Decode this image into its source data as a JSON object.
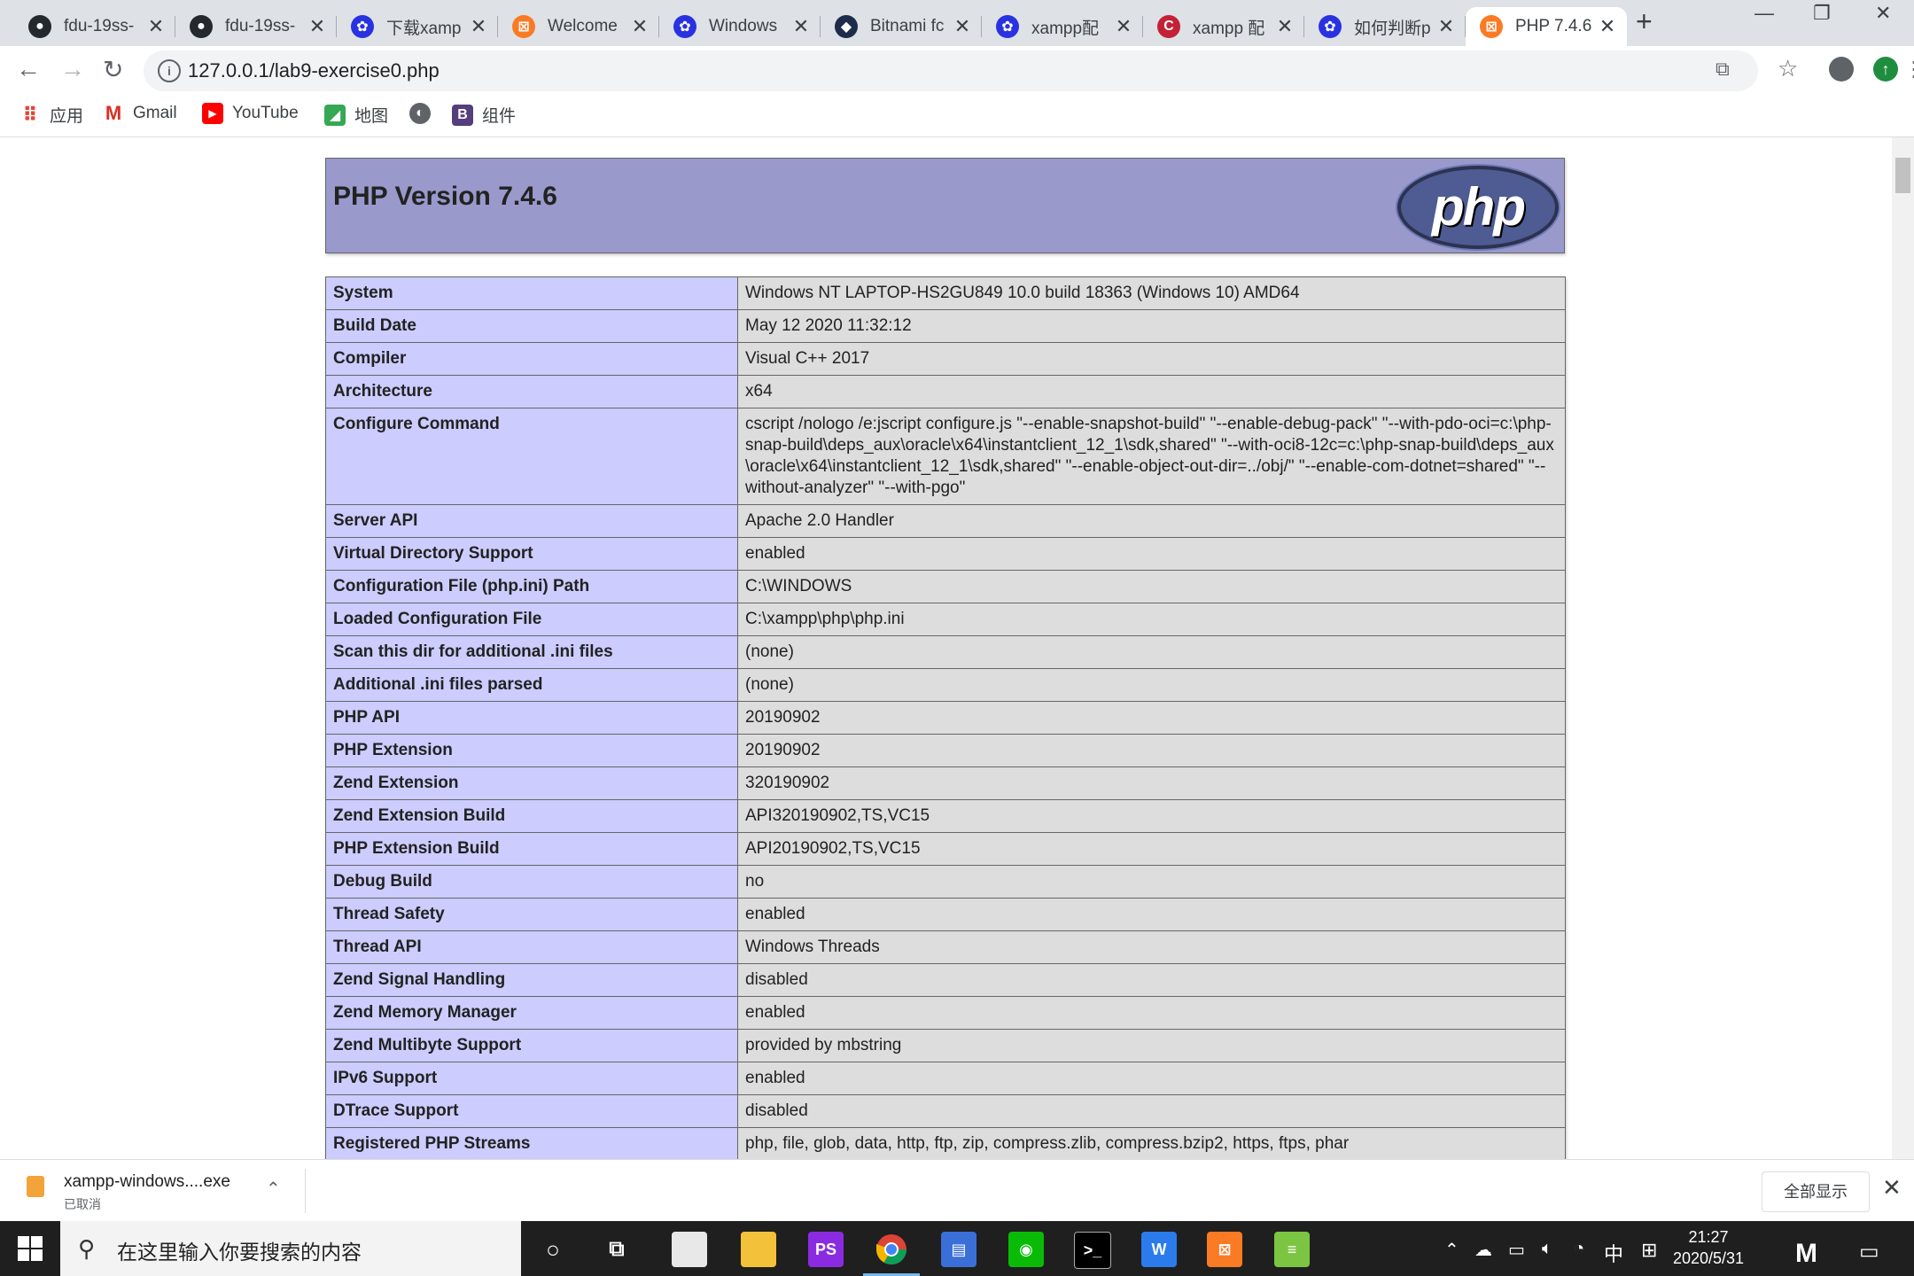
{
  "browser": {
    "tabs": [
      {
        "title": "fdu-19ss-",
        "icon": "github-icon"
      },
      {
        "title": "fdu-19ss-",
        "icon": "github-icon"
      },
      {
        "title": "下载xamp",
        "icon": "baidu-paw-icon"
      },
      {
        "title": "Welcome",
        "icon": "xampp-icon"
      },
      {
        "title": "Windows",
        "icon": "baidu-paw-icon"
      },
      {
        "title": "Bitnami fc",
        "icon": "bitnami-icon"
      },
      {
        "title": "xampp配",
        "icon": "baidu-paw-icon"
      },
      {
        "title": "xampp 配",
        "icon": "csdn-icon"
      },
      {
        "title": "如何判断p",
        "icon": "baidu-paw-icon"
      },
      {
        "title": "PHP 7.4.6",
        "icon": "xampp-icon",
        "active": true
      }
    ],
    "new_tab": "+",
    "url": "127.0.0.1/lab9-exercise0.php",
    "bookmarks": [
      {
        "label": "应用",
        "icon": "apps-grid-icon"
      },
      {
        "label": "Gmail",
        "icon": "gmail-icon"
      },
      {
        "label": "YouTube",
        "icon": "youtube-icon"
      },
      {
        "label": "地图",
        "icon": "maps-icon"
      },
      {
        "label": "",
        "icon": "globe-icon"
      },
      {
        "label": "组件",
        "icon": "bootstrap-icon"
      }
    ]
  },
  "page": {
    "title": "PHP Version 7.4.6",
    "logo_text": "php",
    "rows": [
      {
        "key": "System",
        "value": "Windows NT LAPTOP-HS2GU849 10.0 build 18363 (Windows 10) AMD64"
      },
      {
        "key": "Build Date",
        "value": "May 12 2020 11:32:12"
      },
      {
        "key": "Compiler",
        "value": "Visual C++ 2017"
      },
      {
        "key": "Architecture",
        "value": "x64"
      },
      {
        "key": "Configure Command",
        "value": "cscript /nologo /e:jscript configure.js \"--enable-snapshot-build\" \"--enable-debug-pack\" \"--with-pdo-oci=c:\\php-snap-build\\deps_aux\\oracle\\x64\\instantclient_12_1\\sdk,shared\" \"--with-oci8-12c=c:\\php-snap-build\\deps_aux\\oracle\\x64\\instantclient_12_1\\sdk,shared\" \"--enable-object-out-dir=../obj/\" \"--enable-com-dotnet=shared\" \"--without-analyzer\" \"--with-pgo\""
      },
      {
        "key": "Server API",
        "value": "Apache 2.0 Handler"
      },
      {
        "key": "Virtual Directory Support",
        "value": "enabled"
      },
      {
        "key": "Configuration File (php.ini) Path",
        "value": "C:\\WINDOWS"
      },
      {
        "key": "Loaded Configuration File",
        "value": "C:\\xampp\\php\\php.ini"
      },
      {
        "key": "Scan this dir for additional .ini files",
        "value": "(none)"
      },
      {
        "key": "Additional .ini files parsed",
        "value": "(none)"
      },
      {
        "key": "PHP API",
        "value": "20190902"
      },
      {
        "key": "PHP Extension",
        "value": "20190902"
      },
      {
        "key": "Zend Extension",
        "value": "320190902"
      },
      {
        "key": "Zend Extension Build",
        "value": "API320190902,TS,VC15"
      },
      {
        "key": "PHP Extension Build",
        "value": "API20190902,TS,VC15"
      },
      {
        "key": "Debug Build",
        "value": "no"
      },
      {
        "key": "Thread Safety",
        "value": "enabled"
      },
      {
        "key": "Thread API",
        "value": "Windows Threads"
      },
      {
        "key": "Zend Signal Handling",
        "value": "disabled"
      },
      {
        "key": "Zend Memory Manager",
        "value": "enabled"
      },
      {
        "key": "Zend Multibyte Support",
        "value": "provided by mbstring"
      },
      {
        "key": "IPv6 Support",
        "value": "enabled"
      },
      {
        "key": "DTrace Support",
        "value": "disabled"
      },
      {
        "key": "Registered PHP Streams",
        "value": "php, file, glob, data, http, ftp, zip, compress.zlib, compress.bzip2, https, ftps, phar"
      }
    ]
  },
  "downloads": {
    "file": "xampp-windows....exe",
    "status": "已取消",
    "show_all": "全部显示"
  },
  "taskbar": {
    "search_placeholder": "在这里输入你要搜索的内容",
    "ime": "中",
    "time": "21:27",
    "date": "2020/5/31"
  },
  "colors": {
    "php_header": "#9999cc",
    "key_cell": "#ccccff",
    "value_cell": "#dddddd"
  }
}
